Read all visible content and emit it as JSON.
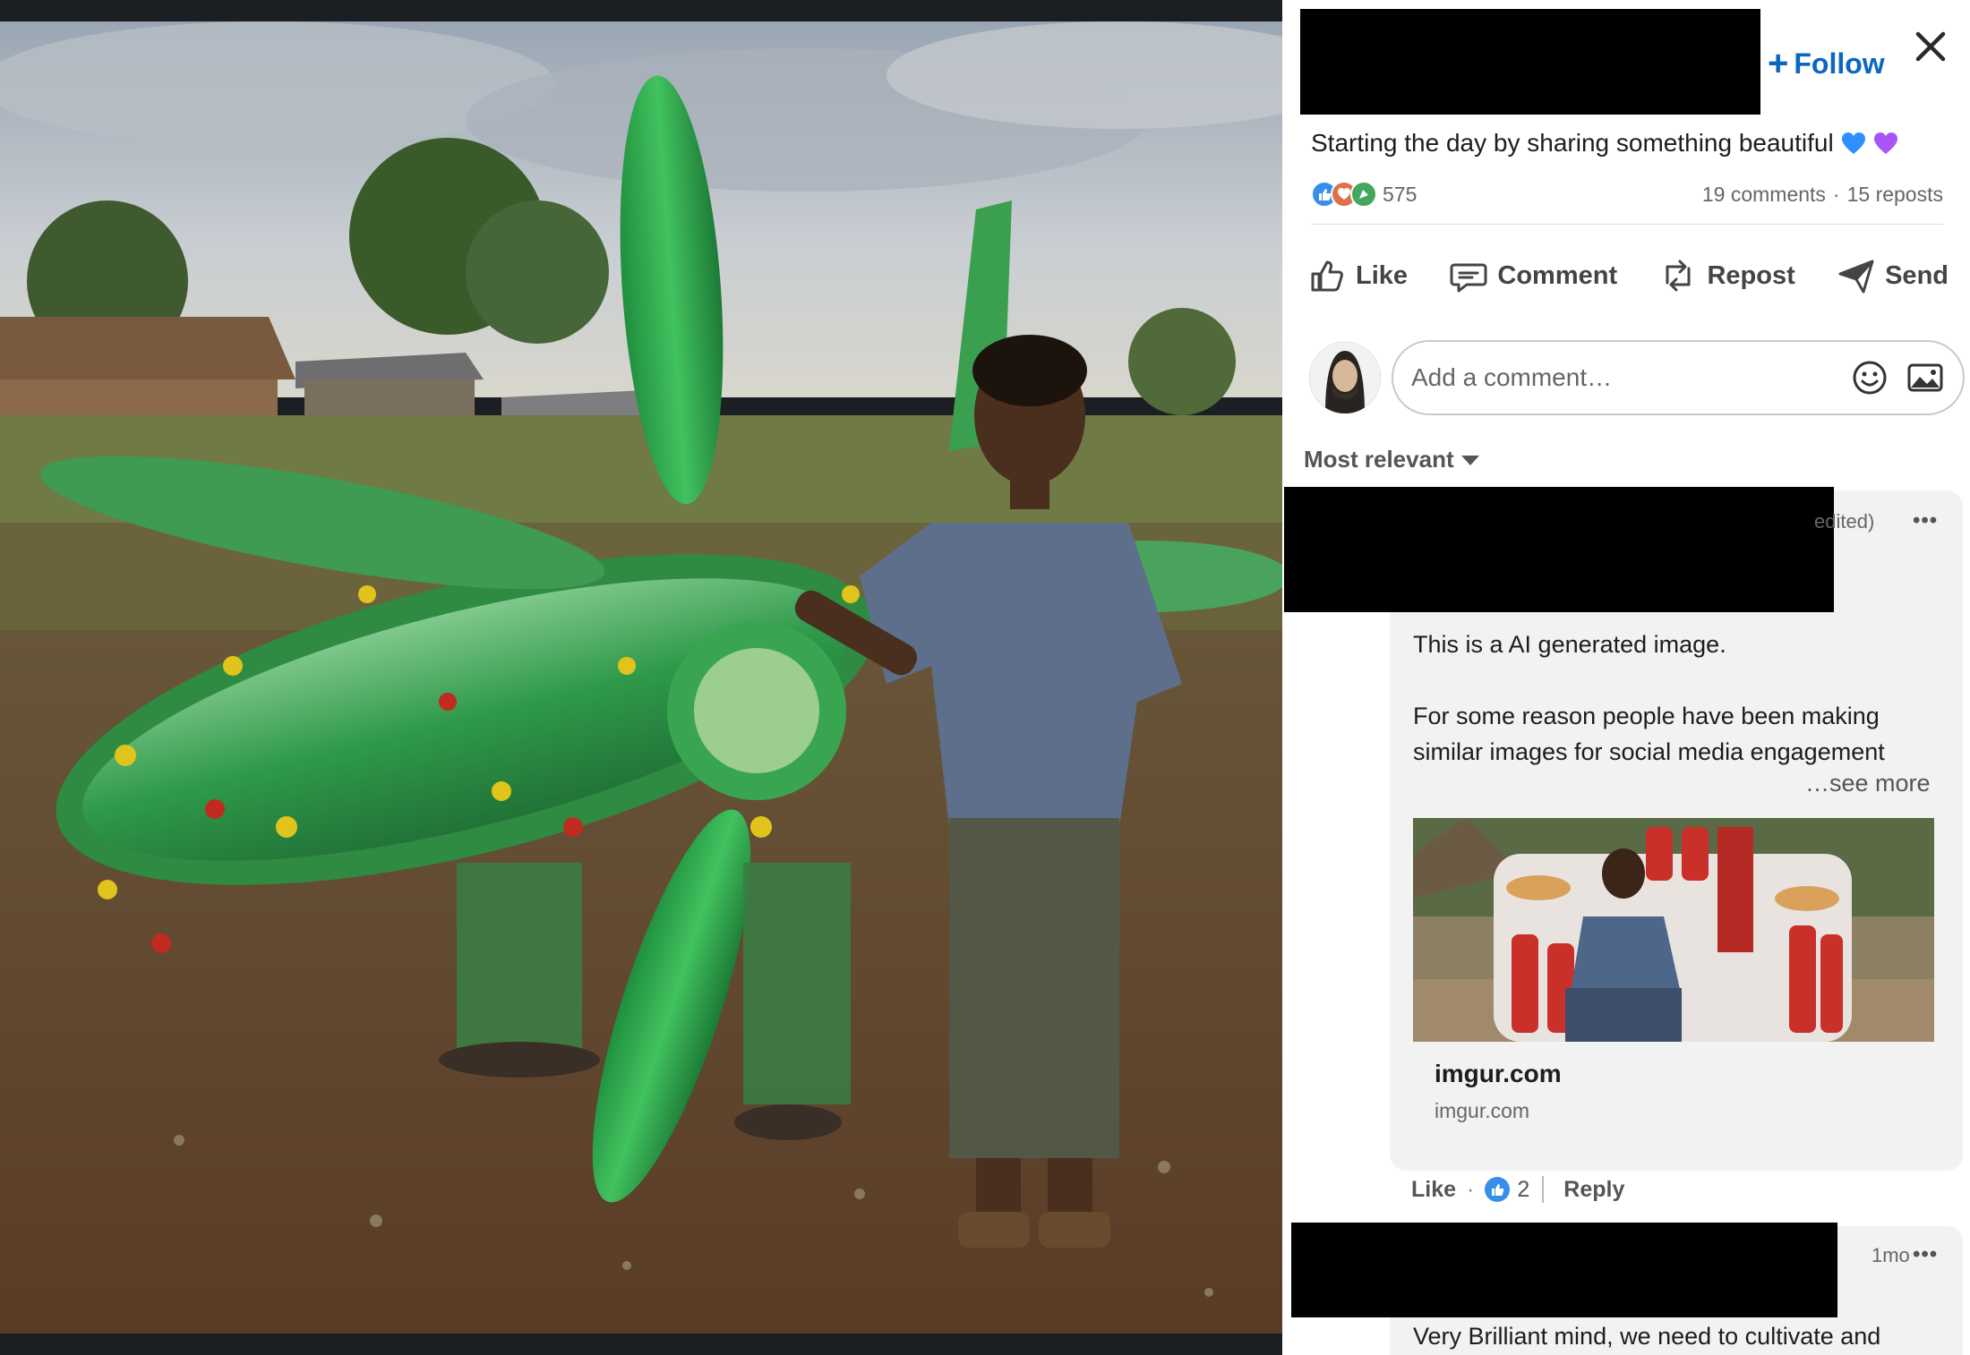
{
  "post": {
    "follow_label": "Follow",
    "text": "Starting the day by sharing something beautiful",
    "reaction_count": "575",
    "comments": "19 comments",
    "separator": "·",
    "reposts": "15 reposts"
  },
  "actions": {
    "like": "Like",
    "comment": "Comment",
    "repost": "Repost",
    "send": "Send"
  },
  "comment_input": {
    "placeholder": "Add a comment…"
  },
  "sort": {
    "label": "Most relevant"
  },
  "comments": [
    {
      "meta": "edited)",
      "more": "•••",
      "paragraph_1": "This is a AI generated image.",
      "paragraph_2": "For some reason people have been making similar images for social media engagement",
      "see_more": "…see more",
      "link": {
        "title": "imgur.com",
        "domain": "imgur.com"
      },
      "like_label": "Like",
      "dot": "·",
      "like_count": "2",
      "reply_label": "Reply"
    },
    {
      "meta": "1mo",
      "more": "•••",
      "text": "Very Brilliant mind, we need to cultivate and"
    }
  ],
  "colors": {
    "accent": "#0a66c2",
    "like_blue": "#378fe9",
    "heart_blue": "#2f8fff",
    "heart_purple": "#a855f7",
    "redaction": "#000000"
  },
  "icons": {
    "close": "close-icon",
    "like": "thumbs-up-icon",
    "comment": "speech-bubble-icon",
    "repost": "repost-icon",
    "send": "paper-plane-icon",
    "emoji": "smiley-icon",
    "image": "image-icon"
  }
}
